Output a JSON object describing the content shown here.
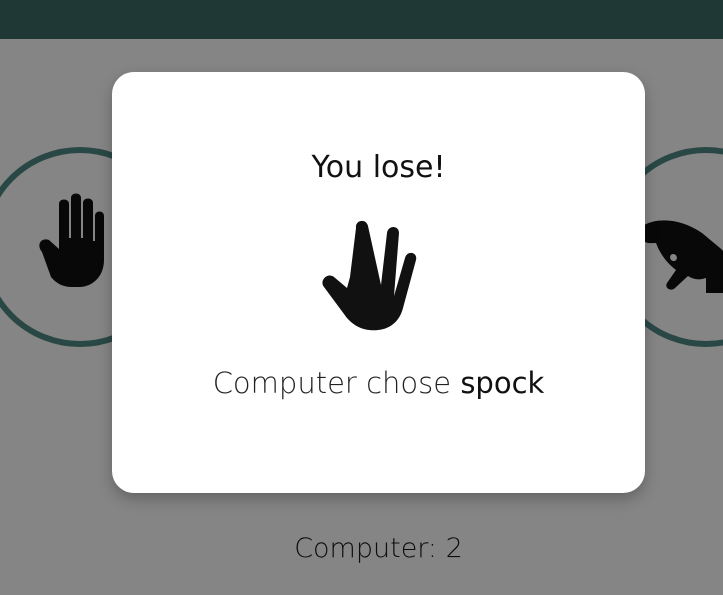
{
  "background": {
    "header_color": "#3f6b66",
    "accent_color": "#4f8a84",
    "overlay_color": "rgba(0,0,0,0.48)"
  },
  "choices": {
    "left_icon": "hand-paper-icon",
    "right_icon": "hand-lizard-icon"
  },
  "scoreboard": {
    "computer_score_label": "Computer: 2"
  },
  "modal": {
    "title": "You lose!",
    "icon": "hand-spock-icon",
    "result_prefix": "Computer chose ",
    "result_choice": "spock"
  }
}
